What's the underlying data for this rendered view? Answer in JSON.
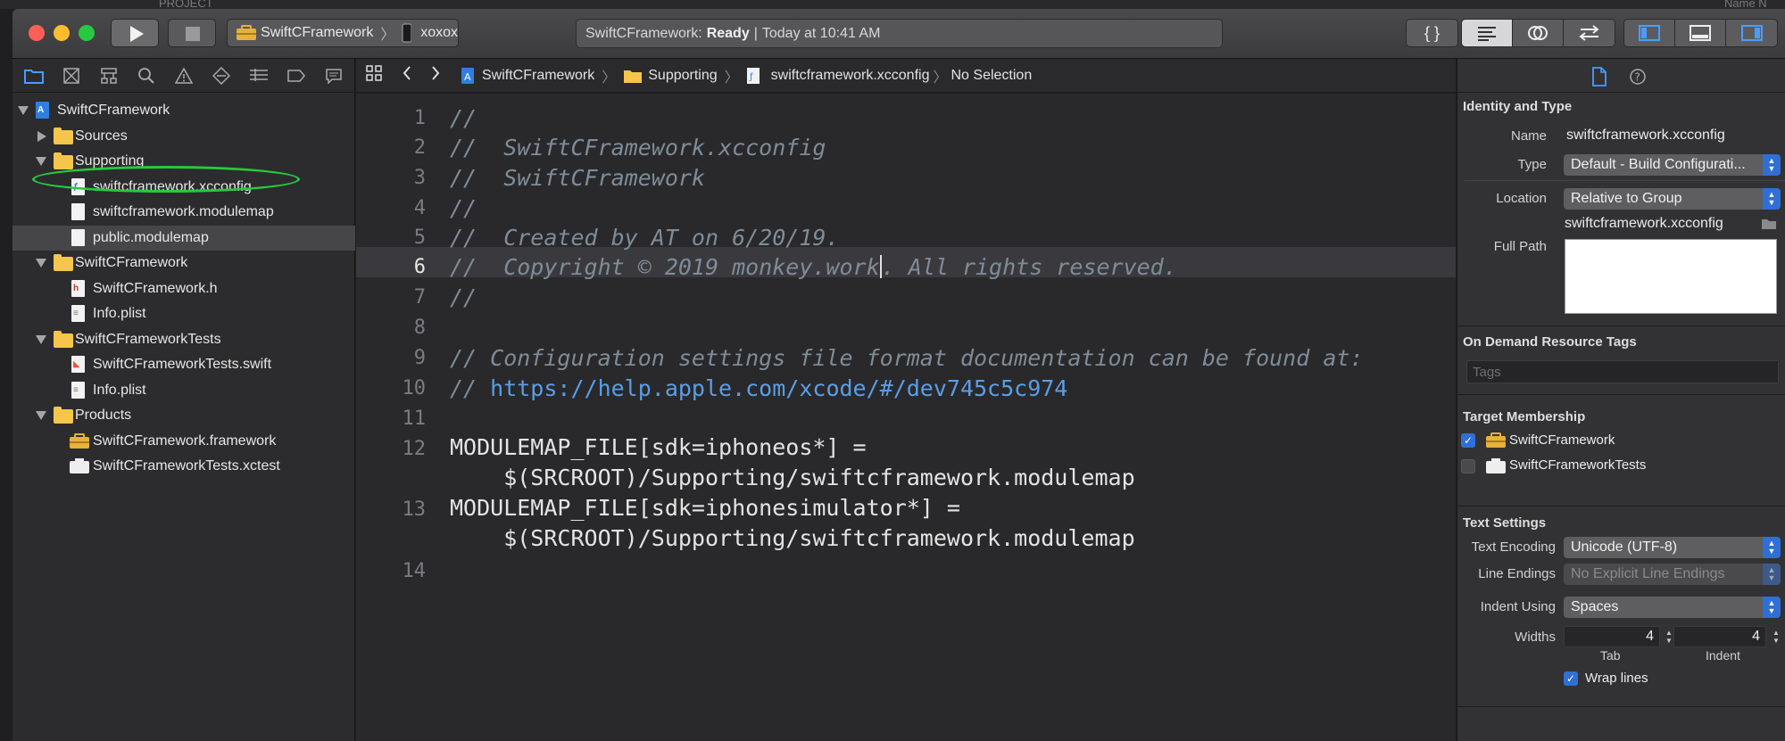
{
  "window": {
    "traffic_colors": [
      "#ff5f57",
      "#febc2e",
      "#28c840"
    ]
  },
  "background_strip": {
    "left_text": "PROJECT",
    "right_text": "Name  N"
  },
  "toolbar": {
    "scheme_name": "SwiftCFramework",
    "device_name": "xoxox",
    "status_project": "SwiftCFramework:",
    "status_state": "Ready",
    "status_time": "Today at 10:41 AM"
  },
  "navigator": {
    "items": [
      {
        "label": "SwiftCFramework",
        "kind": "project",
        "level": 0,
        "expanded": true
      },
      {
        "label": "Sources",
        "kind": "folder",
        "level": 1,
        "expanded": false
      },
      {
        "label": "Supporting",
        "kind": "folder",
        "level": 1,
        "expanded": true
      },
      {
        "label": "swiftcframework.xcconfig",
        "kind": "xcconfig",
        "level": 2,
        "circled": true
      },
      {
        "label": "swiftcframework.modulemap",
        "kind": "file",
        "level": 2
      },
      {
        "label": "public.modulemap",
        "kind": "file",
        "level": 2,
        "selected": true
      },
      {
        "label": "SwiftCFramework",
        "kind": "folder",
        "level": 1,
        "expanded": true
      },
      {
        "label": "SwiftCFramework.h",
        "kind": "header",
        "level": 2
      },
      {
        "label": "Info.plist",
        "kind": "plist",
        "level": 2
      },
      {
        "label": "SwiftCFrameworkTests",
        "kind": "folder",
        "level": 1,
        "expanded": true
      },
      {
        "label": "SwiftCFrameworkTests.swift",
        "kind": "swift",
        "level": 2
      },
      {
        "label": "Info.plist",
        "kind": "plist",
        "level": 2
      },
      {
        "label": "Products",
        "kind": "folder",
        "level": 1,
        "expanded": true
      },
      {
        "label": "SwiftCFramework.framework",
        "kind": "framework",
        "level": 2
      },
      {
        "label": "SwiftCFrameworkTests.xctest",
        "kind": "xctest",
        "level": 2
      }
    ]
  },
  "jumpbar": {
    "crumbs": [
      "SwiftCFramework",
      "Supporting",
      "swiftcframework.xcconfig",
      "No Selection"
    ]
  },
  "editor": {
    "current_line": 6,
    "lines": [
      {
        "n": "1",
        "text": "//",
        "style": "comment"
      },
      {
        "n": "2",
        "text": "//  SwiftCFramework.xcconfig",
        "style": "comment"
      },
      {
        "n": "3",
        "text": "//  SwiftCFramework",
        "style": "comment"
      },
      {
        "n": "4",
        "text": "//",
        "style": "comment"
      },
      {
        "n": "5",
        "text": "//  Created by AT on 6/20/19.",
        "style": "comment"
      },
      {
        "n": "6",
        "text_before_caret": "//  Copyright © 2019 monkey.work",
        "text_after_caret": ". All rights reserved.",
        "style": "comment"
      },
      {
        "n": "7",
        "text": "//",
        "style": "comment"
      },
      {
        "n": "8",
        "text": "",
        "style": "plain"
      },
      {
        "n": "9",
        "text": "// Configuration settings file format documentation can be found at:",
        "style": "comment"
      },
      {
        "n": "10",
        "prefix": "// ",
        "link": "https://help.apple.com/xcode/#/dev745c5c974",
        "style": "comment"
      },
      {
        "n": "11",
        "text": "",
        "style": "plain"
      },
      {
        "n": "12",
        "text": "MODULEMAP_FILE[sdk=iphoneos*] =",
        "cont": "    $(SRCROOT)/Supporting/swiftcframework.modulemap",
        "style": "plain"
      },
      {
        "n": "13",
        "text": "MODULEMAP_FILE[sdk=iphonesimulator*] =",
        "cont": "    $(SRCROOT)/Supporting/swiftcframework.modulemap",
        "style": "plain"
      },
      {
        "n": "14",
        "text": "",
        "style": "plain"
      }
    ]
  },
  "inspector": {
    "identity": {
      "title": "Identity and Type",
      "name_label": "Name",
      "name_value": "swiftcframework.xcconfig",
      "type_label": "Type",
      "type_value": "Default - Build Configurati...",
      "location_label": "Location",
      "location_value": "Relative to Group",
      "location_file": "swiftcframework.xcconfig",
      "full_path_label": "Full Path"
    },
    "odr": {
      "title": "On Demand Resource Tags",
      "tags_placeholder": "Tags"
    },
    "membership": {
      "title": "Target Membership",
      "targets": [
        {
          "name": "SwiftCFramework",
          "checked": true
        },
        {
          "name": "SwiftCFrameworkTests",
          "checked": false
        }
      ]
    },
    "text_settings": {
      "title": "Text Settings",
      "encoding_label": "Text Encoding",
      "encoding_value": "Unicode (UTF-8)",
      "line_endings_label": "Line Endings",
      "line_endings_value": "No Explicit Line Endings",
      "indent_label": "Indent Using",
      "indent_value": "Spaces",
      "widths_label": "Widths",
      "tab_width": "4",
      "indent_width": "4",
      "tab_caption": "Tab",
      "indent_caption": "Indent",
      "wrap_label": "Wrap lines",
      "wrap_checked": true
    }
  }
}
